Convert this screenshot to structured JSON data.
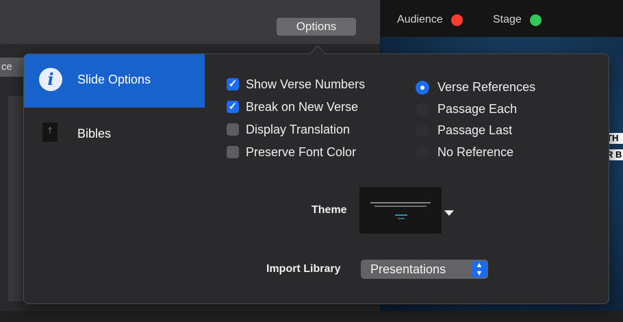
{
  "toolbar": {
    "options_label": "Options"
  },
  "status": {
    "audience_label": "Audience",
    "audience_color": "#ff3b30",
    "stage_label": "Stage",
    "stage_color": "#34c759"
  },
  "background": {
    "left_tab_fragment": "ce",
    "preview_fragments": [
      "TH",
      "R B"
    ]
  },
  "popover": {
    "sidebar": [
      {
        "label": "Slide Options",
        "icon": "info-icon",
        "selected": true
      },
      {
        "label": "Bibles",
        "icon": "bible-icon",
        "selected": false
      }
    ],
    "checkboxes": [
      {
        "label": "Show Verse Numbers",
        "checked": true
      },
      {
        "label": "Break on New Verse",
        "checked": true
      },
      {
        "label": "Display Translation",
        "checked": false
      },
      {
        "label": "Preserve Font Color",
        "checked": false
      }
    ],
    "radios": [
      {
        "label": "Verse References",
        "selected": true
      },
      {
        "label": "Passage Each",
        "selected": false
      },
      {
        "label": "Passage Last",
        "selected": false
      },
      {
        "label": "No Reference",
        "selected": false
      }
    ],
    "theme_label": "Theme",
    "import_library_label": "Import Library",
    "import_library_value": "Presentations",
    "accent_color": "#1a6cf0"
  }
}
